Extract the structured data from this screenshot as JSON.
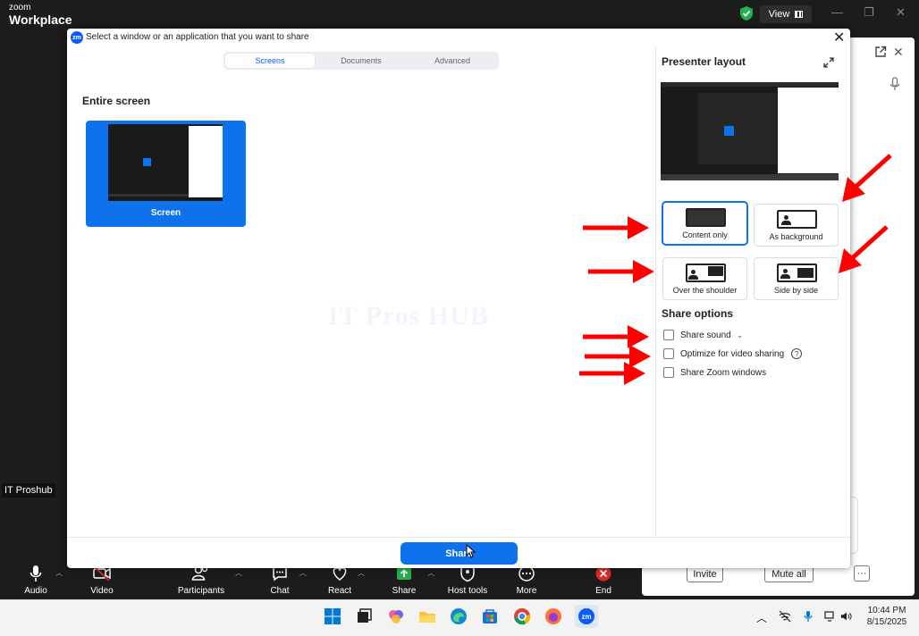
{
  "zoom": {
    "brand_top": "zoom",
    "brand_bottom": "Workplace",
    "view_label": "View",
    "participant_name": "IT Proshub",
    "toolbar": [
      {
        "label": "Audio",
        "icon": "mic-icon"
      },
      {
        "label": "Video",
        "icon": "video-off-icon"
      },
      {
        "label": "Participants",
        "icon": "participants-icon"
      },
      {
        "label": "Chat",
        "icon": "chat-icon"
      },
      {
        "label": "React",
        "icon": "react-icon"
      },
      {
        "label": "Share",
        "icon": "share-icon"
      },
      {
        "label": "Host tools",
        "icon": "host-tools-icon"
      },
      {
        "label": "More",
        "icon": "more-icon"
      },
      {
        "label": "End",
        "icon": "end-icon"
      }
    ],
    "panel": {
      "invite_label": "Invite",
      "mute_all_label": "Mute all",
      "more_label": "···"
    }
  },
  "dialog": {
    "title": "Select a window or an application that you want to share",
    "tabs": [
      {
        "label": "Screens",
        "active": true
      },
      {
        "label": "Documents",
        "active": false
      },
      {
        "label": "Advanced",
        "active": false
      }
    ],
    "entire_screen_title": "Entire screen",
    "screen_label": "Screen",
    "share_button": "Share",
    "watermark": "IT Pros HUB",
    "presenter_layout_title": "Presenter layout",
    "layouts": [
      {
        "label": "Content only",
        "selected": true
      },
      {
        "label": "As background",
        "selected": false
      },
      {
        "label": "Over the shoulder",
        "selected": false
      },
      {
        "label": "Side by side",
        "selected": false
      }
    ],
    "share_options_title": "Share options",
    "options": [
      {
        "label": "Share sound",
        "checked": false
      },
      {
        "label": "Optimize for video sharing",
        "checked": false
      },
      {
        "label": "Share Zoom windows",
        "checked": false
      }
    ]
  },
  "taskbar": {
    "time": "10:44 PM",
    "date": "8/15/2025"
  },
  "colors": {
    "accent": "#0e72ed",
    "zoom_blue": "#0b5cff",
    "annotation_red": "#ff0000"
  }
}
